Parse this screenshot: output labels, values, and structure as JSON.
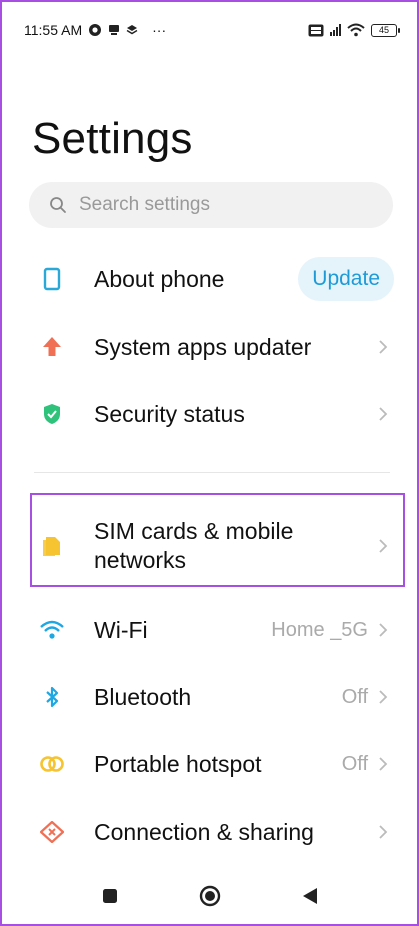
{
  "status_bar": {
    "time": "11:55 AM",
    "overflow": "···",
    "battery": "45"
  },
  "page": {
    "title": "Settings"
  },
  "search": {
    "placeholder": "Search settings"
  },
  "items": [
    {
      "id": "about",
      "label": "About phone",
      "action_label": "Update",
      "icon": "phone-outline-icon",
      "color": "#2aa8d8"
    },
    {
      "id": "apps-updater",
      "label": "System apps updater",
      "icon": "arrow-up-icon",
      "color": "#f07055"
    },
    {
      "id": "security",
      "label": "Security status",
      "icon": "shield-check-icon",
      "color": "#2fc27a"
    },
    {
      "id": "sim",
      "label": "SIM cards & mobile networks",
      "icon": "sim-card-icon",
      "color": "#f5c430"
    },
    {
      "id": "wifi",
      "label": "Wi-Fi",
      "value": "Home _5G",
      "icon": "wifi-icon",
      "color": "#1ea7e2"
    },
    {
      "id": "bluetooth",
      "label": "Bluetooth",
      "value": "Off",
      "icon": "bluetooth-icon",
      "color": "#1ea7e2"
    },
    {
      "id": "hotspot",
      "label": "Portable hotspot",
      "value": "Off",
      "icon": "hotspot-icon",
      "color": "#f5c430"
    },
    {
      "id": "sharing",
      "label": "Connection & sharing",
      "icon": "connection-sharing-icon",
      "color": "#f07055"
    }
  ],
  "nav": [
    "recents-icon",
    "home-icon",
    "back-icon"
  ],
  "colors": {
    "highlight": "#a64fe0",
    "accent": "#1e9bd7"
  }
}
